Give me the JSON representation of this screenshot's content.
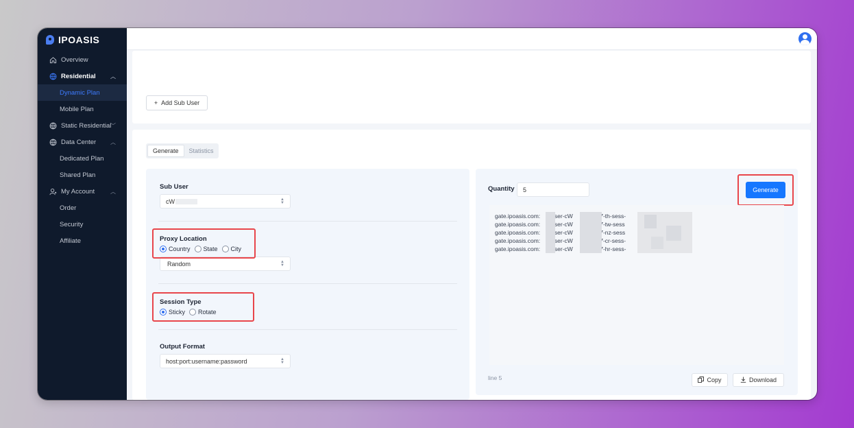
{
  "app": {
    "logo_text": "IPOASIS"
  },
  "sidebar": {
    "items": [
      {
        "label": "Overview",
        "icon": "home-icon"
      },
      {
        "label": "Residential",
        "icon": "globe-icon",
        "expanded": true
      },
      {
        "label": "Dynamic Plan",
        "active": true
      },
      {
        "label": "Mobile Plan"
      },
      {
        "label": "Static Residential",
        "icon": "globe-icon"
      },
      {
        "label": "Data Center",
        "icon": "globe-icon",
        "expanded": true
      },
      {
        "label": "Dedicated Plan"
      },
      {
        "label": "Shared Plan"
      },
      {
        "label": "My Account",
        "icon": "user-icon",
        "expanded": true
      },
      {
        "label": "Order"
      },
      {
        "label": "Security"
      },
      {
        "label": "Affiliate"
      }
    ]
  },
  "top_card": {
    "add_sub_user_label": "Add Sub User"
  },
  "tabs": [
    {
      "label": "Generate",
      "active": true
    },
    {
      "label": "Statistics"
    }
  ],
  "form": {
    "sub_user_label": "Sub User",
    "sub_user_value": "cW",
    "proxy_location_label": "Proxy Location",
    "proxy_location_options": [
      "Country",
      "State",
      "City"
    ],
    "proxy_location_selected": "Country",
    "region_value": "Random",
    "session_type_label": "Session Type",
    "session_type_options": [
      "Sticky",
      "Rotate"
    ],
    "session_type_selected": "Sticky",
    "output_format_label": "Output Format",
    "output_format_value": "host:port:username:password"
  },
  "generator": {
    "quantity_label": "Quantity",
    "quantity_value": "5",
    "generate_label": "Generate",
    "lines": [
      {
        "host": "gate.ipoasis.com:",
        "user": "user-cW",
        "tail": "307-th-sess-"
      },
      {
        "host": "gate.ipoasis.com:",
        "user": "user-cW",
        "tail": "307-tw-sess"
      },
      {
        "host": "gate.ipoasis.com:",
        "user": "user-cW",
        "tail": "307-nz-sess"
      },
      {
        "host": "gate.ipoasis.com:",
        "user": "user-cW",
        "tail": "307-cr-sess-"
      },
      {
        "host": "gate.ipoasis.com:",
        "user": "user-cW",
        "tail": "307-hr-sess-"
      }
    ],
    "line_count": "line 5",
    "copy_label": "Copy",
    "download_label": "Download"
  },
  "colors": {
    "accent": "#1677ff",
    "highlight": "#e8454a",
    "sidebar_bg": "#0f1a2c"
  }
}
